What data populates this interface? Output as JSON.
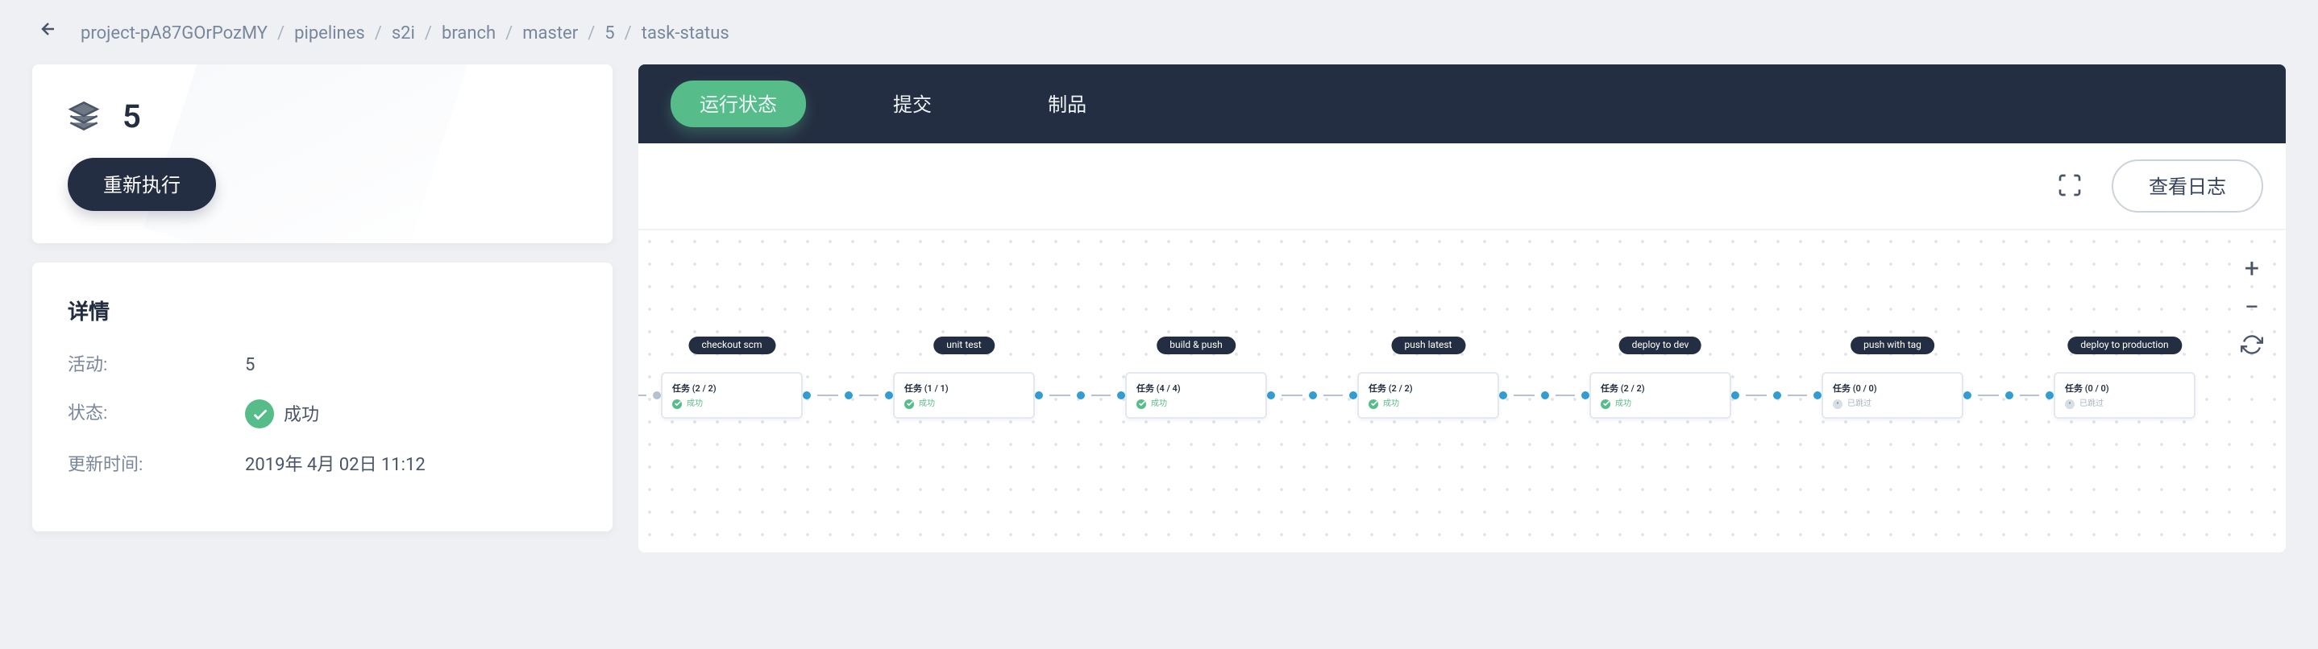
{
  "breadcrumb": {
    "items": [
      "project-pA87GOrPozMY",
      "pipelines",
      "s2i",
      "branch",
      "master",
      "5",
      "task-status"
    ]
  },
  "header": {
    "run_number": "5",
    "rerun_label": "重新执行"
  },
  "details": {
    "title": "详情",
    "activity_label": "活动:",
    "activity_value": "5",
    "status_label": "状态:",
    "status_value": "成功",
    "updated_label": "更新时间:",
    "updated_value": "2019年 4月 02日 11:12"
  },
  "tabs": {
    "run_status": "运行状态",
    "commit": "提交",
    "artifacts": "制品"
  },
  "toolbar": {
    "view_log_label": "查看日志"
  },
  "stages": [
    {
      "name": "checkout scm",
      "tasks": "任务 (2 / 2)",
      "status_text": "成功",
      "status": "success"
    },
    {
      "name": "unit test",
      "tasks": "任务 (1 / 1)",
      "status_text": "成功",
      "status": "success"
    },
    {
      "name": "build & push",
      "tasks": "任务 (4 / 4)",
      "status_text": "成功",
      "status": "success"
    },
    {
      "name": "push latest",
      "tasks": "任务 (2 / 2)",
      "status_text": "成功",
      "status": "success"
    },
    {
      "name": "deploy to dev",
      "tasks": "任务 (2 / 2)",
      "status_text": "成功",
      "status": "success"
    },
    {
      "name": "push with tag",
      "tasks": "任务 (0 / 0)",
      "status_text": "已跳过",
      "status": "skipped"
    },
    {
      "name": "deploy to production",
      "tasks": "任务 (0 / 0)",
      "status_text": "已跳过",
      "status": "skipped"
    }
  ]
}
